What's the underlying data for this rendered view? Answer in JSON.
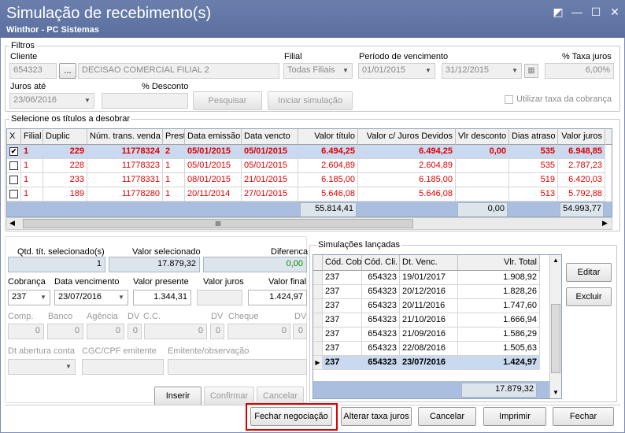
{
  "window": {
    "title": "Simulação de recebimento(s)",
    "subtitle": "Winthor - PC Sistemas",
    "icons": [
      "restore-icon",
      "minimize-icon",
      "maximize-icon",
      "close-icon"
    ]
  },
  "filtros": {
    "group_title": "Filtros",
    "cliente_label": "Cliente",
    "cliente_code": "654323",
    "cliente_btn": "...",
    "cliente_name": "DECISAO COMERCIAL FILIAL 2",
    "filial_label": "Filial",
    "filial_value": "Todas Filiais",
    "periodo_label": "Período de vencimento",
    "periodo_ini": "01/01/2015",
    "periodo_fim": "31/12/2015",
    "taxa_label": "% Taxa juros",
    "taxa_value": "6,00%",
    "juros_ate_label": "Juros até",
    "juros_ate_value": "23/06/2016",
    "desconto_label": "% Desconto",
    "desconto_value": "",
    "pesquisar": "Pesquisar",
    "iniciar": "Iniciar simulação",
    "utilizar_taxa": "Utilizar taxa da cobrança"
  },
  "titulos": {
    "group_title": "Selecione os títulos a desobrar",
    "columns": [
      "X",
      "Filial",
      "Duplic",
      "Núm. trans. venda",
      "Prest",
      "Data emissão",
      "Data vencto",
      "Valor título",
      "Valor c/ Juros Devidos",
      "Vlr desconto",
      "Dias atraso",
      "Valor juros"
    ],
    "rows": [
      {
        "checked": "✔",
        "filial": "1",
        "duplic": "229",
        "trans": "11778324",
        "prest": "2",
        "emissao": "05/01/2015",
        "vencto": "05/01/2015",
        "valor": "6.494,25",
        "valor_juros_dev": "6.494,25",
        "desconto": "0,00",
        "dias": "535",
        "juros": "6.948,85"
      },
      {
        "checked": "",
        "filial": "1",
        "duplic": "228",
        "trans": "11778323",
        "prest": "1",
        "emissao": "05/01/2015",
        "vencto": "05/01/2015",
        "valor": "2.604,89",
        "valor_juros_dev": "2.604,89",
        "desconto": "",
        "dias": "535",
        "juros": "2.787,23"
      },
      {
        "checked": "",
        "filial": "1",
        "duplic": "233",
        "trans": "11778331",
        "prest": "1",
        "emissao": "08/01/2015",
        "vencto": "21/01/2015",
        "valor": "6.185,00",
        "valor_juros_dev": "6.185,00",
        "desconto": "",
        "dias": "519",
        "juros": "6.420,03"
      },
      {
        "checked": "",
        "filial": "1",
        "duplic": "189",
        "trans": "11778280",
        "prest": "1",
        "emissao": "20/11/2014",
        "vencto": "27/01/2015",
        "valor": "5.646,08",
        "valor_juros_dev": "5.646,08",
        "desconto": "",
        "dias": "513",
        "juros": "5.792,88"
      }
    ],
    "totals": {
      "valor": "55.814,41",
      "desconto": "0,00",
      "juros": "54.993,77"
    },
    "scroll_thumb": "III"
  },
  "resumo": {
    "qtd_label": "Qtd. tít. selecionado(s)",
    "qtd_value": "1",
    "valor_sel_label": "Valor selecionado",
    "valor_sel_value": "17.879,32",
    "diferenca_label": "Diferenca",
    "diferenca_value": "0,00",
    "cobranca_label": "Cobrança",
    "cobranca_value": "237",
    "data_venc_label": "Data vencimento",
    "data_venc_value": "23/07/2016",
    "valor_presente_label": "Valor presente",
    "valor_presente_value": "1.344,31",
    "valor_juros_label": "Valor juros",
    "valor_juros_value": "",
    "valor_final_label": "Valor final",
    "valor_final_value": "1.424,97",
    "comp_label": "Comp.",
    "banco_label": "Banco",
    "agencia_label": "Agência",
    "dv_label": "DV",
    "cc_label": "C.C.",
    "cheque_label": "Cheque",
    "zero": "0",
    "dt_abertura_label": "Dt abertura conta",
    "cgc_label": "CGC/CPF emitente",
    "emitente_label": "Emitente/observação",
    "inserir": "Inserir",
    "confirmar": "Confirmar",
    "cancelar": "Cancelar"
  },
  "simulacoes": {
    "group_title": "Simulações lançadas",
    "columns": [
      "Cód. Cob",
      "Cód. Cli.",
      "Dt. Venc.",
      "Vlr. Total"
    ],
    "rows": [
      {
        "cob": "237",
        "cli": "654323",
        "venc": "19/01/2017",
        "total": "1.908,92"
      },
      {
        "cob": "237",
        "cli": "654323",
        "venc": "20/12/2016",
        "total": "1.828,26"
      },
      {
        "cob": "237",
        "cli": "654323",
        "venc": "20/11/2016",
        "total": "1.747,60"
      },
      {
        "cob": "237",
        "cli": "654323",
        "venc": "21/10/2016",
        "total": "1.666,94"
      },
      {
        "cob": "237",
        "cli": "654323",
        "venc": "21/09/2016",
        "total": "1.586,29"
      },
      {
        "cob": "237",
        "cli": "654323",
        "venc": "22/08/2016",
        "total": "1.505,63"
      },
      {
        "cob": "237",
        "cli": "654323",
        "venc": "23/07/2016",
        "total": "1.424,97"
      }
    ],
    "total": "17.879,32",
    "editar": "Editar",
    "excluir": "Excluir"
  },
  "footer": {
    "fechar_neg": "Fechar negociação",
    "alterar": "Alterar taxa juros",
    "cancelar": "Cancelar",
    "imprimir": "Imprimir",
    "fechar": "Fechar"
  }
}
